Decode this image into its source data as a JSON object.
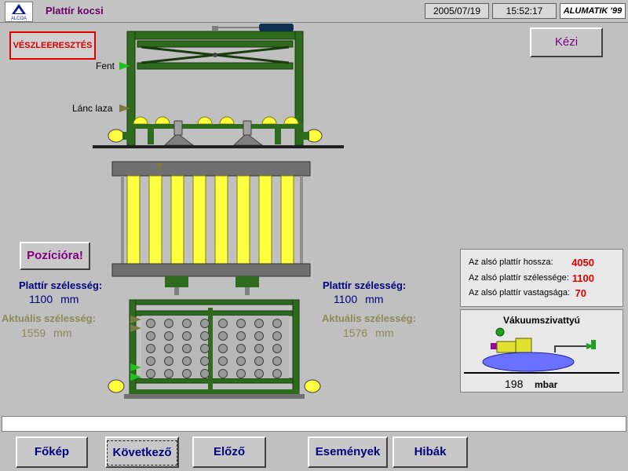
{
  "header": {
    "logo_text": "ALCOA",
    "title": "Plattír kocsi",
    "date": "2005/07/19",
    "time": "15:52:17",
    "brand": "ALUMATIK '99"
  },
  "emergency_stop_label": "VÉSZLEERESZTÉS",
  "mode_button_label": "Kézi",
  "position_button_label": "Pozícióra!",
  "machine_labels": {
    "top": "Fent",
    "chain_loose": "Lánc laza"
  },
  "left_side": {
    "width_label": "Plattír szélesség:",
    "width_value": "1100",
    "width_unit": "mm",
    "actual_label": "Aktuális szélesség:",
    "actual_value": "1559",
    "actual_unit": "mm"
  },
  "right_side": {
    "width_label": "Plattír szélesség:",
    "width_value": "1100",
    "width_unit": "mm",
    "actual_label": "Aktuális szélesség:",
    "actual_value": "1576",
    "actual_unit": "mm"
  },
  "info_panel": {
    "rows": [
      {
        "label": "Az alsó plattír hossza:",
        "value": "4050"
      },
      {
        "label": "Az alsó plattír szélessége:",
        "value": "1100"
      },
      {
        "label": "Az alsó plattír vastagsága:",
        "value": "70"
      }
    ]
  },
  "vacuum": {
    "title": "Vákuumszivattyú",
    "value": "198",
    "unit": "mbar"
  },
  "nav": [
    {
      "label": "Főkép"
    },
    {
      "label": "Következő"
    },
    {
      "label": "Előző"
    },
    {
      "label": "Események"
    },
    {
      "label": "Hibák"
    }
  ],
  "colors": {
    "frame_green": "#2e6b1c",
    "alert_red": "#e00000",
    "roller_yellow": "#ffff40",
    "title_purple": "#6a006a"
  }
}
